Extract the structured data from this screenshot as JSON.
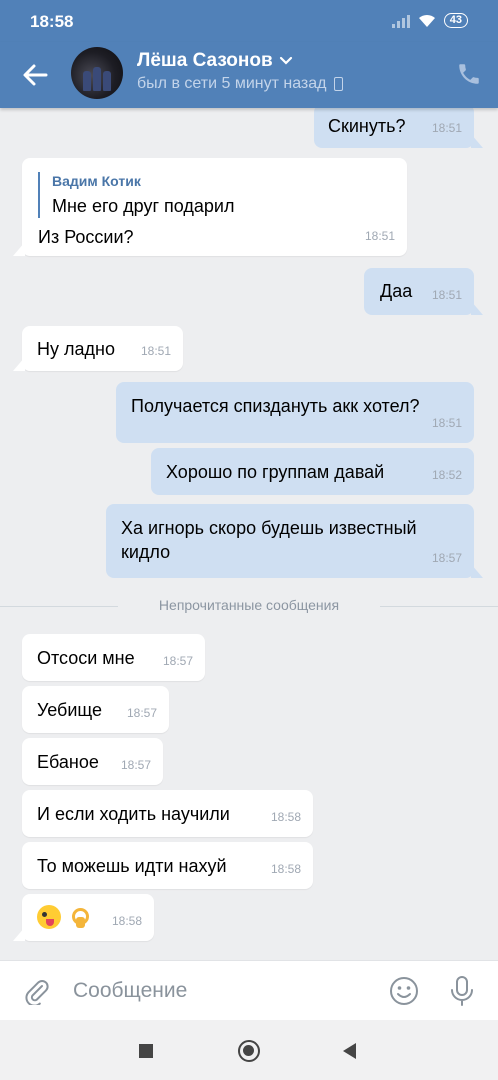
{
  "status_bar": {
    "time": "18:58",
    "battery": "43"
  },
  "header": {
    "contact_name": "Лёша Сазонов",
    "status": "был в сети 5 минут назад"
  },
  "messages": [
    {
      "dir": "out",
      "text": "Скинуть?",
      "time": "18:51"
    },
    {
      "dir": "in",
      "quote_author": "Вадим Котик",
      "quote_text": "Мне его друг подарил",
      "text": "Из России?",
      "time": "18:51"
    },
    {
      "dir": "out",
      "text": "Даа",
      "time": "18:51"
    },
    {
      "dir": "in",
      "text": "Ну ладно",
      "time": "18:51"
    },
    {
      "dir": "out",
      "text": "Получается спиздануть акк хотел?",
      "time": "18:51"
    },
    {
      "dir": "out",
      "text": "Хорошо по группам давай",
      "time": "18:52"
    },
    {
      "dir": "out",
      "text_line1": "Ха игнорь скоро будешь известный",
      "text_line2": "кидло",
      "time": "18:57"
    },
    {
      "dir": "in",
      "text": "Отсоси мне",
      "time": "18:57"
    },
    {
      "dir": "in",
      "text": "Уебище",
      "time": "18:57"
    },
    {
      "dir": "in",
      "text": "Ебаное",
      "time": "18:57"
    },
    {
      "dir": "in",
      "text": "И если ходить научили",
      "time": "18:58"
    },
    {
      "dir": "in",
      "text": "То можешь идти нахуй",
      "time": "18:58"
    },
    {
      "dir": "in",
      "emojis": [
        "crazy-face-emoji",
        "ok-hand-emoji"
      ],
      "time": "18:58"
    }
  ],
  "unread_divider": "Непрочитанные сообщения",
  "composer": {
    "placeholder": "Сообщение"
  },
  "colors": {
    "header": "#5181b8",
    "outgoing": "#cfdff2",
    "incoming": "#ffffff",
    "background": "#edeef0"
  }
}
